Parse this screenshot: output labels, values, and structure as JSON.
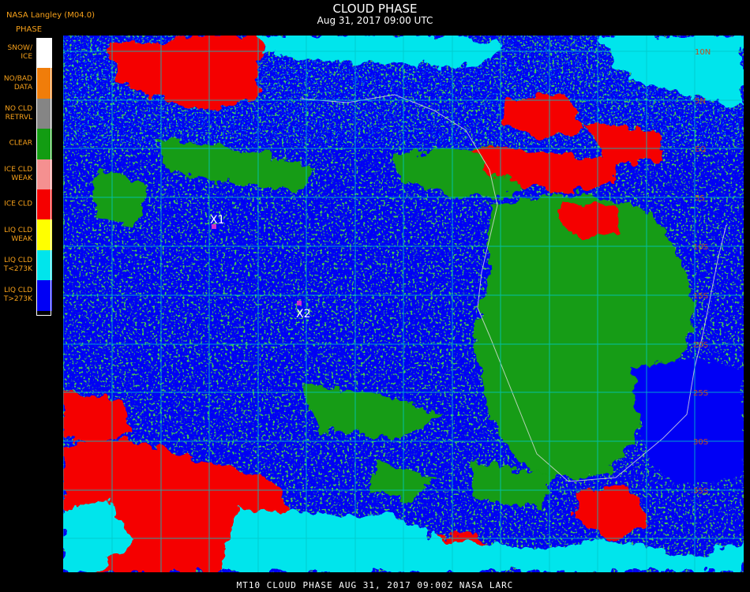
{
  "header": {
    "source": "NASA Langley (M04.0)",
    "title": "CLOUD PHASE",
    "subtitle": "Aug 31, 2017 09:00 UTC"
  },
  "legend": {
    "title": "PHASE",
    "items": [
      {
        "label": "SNOW/\nICE",
        "color": "#ffffff"
      },
      {
        "label": "NO/BAD\nDATA",
        "color": "#f07d0a"
      },
      {
        "label": "NO CLD\nRETRVL",
        "color": "#858585"
      },
      {
        "label": "CLEAR",
        "color": "#129c12"
      },
      {
        "label": "ICE CLD\nWEAK",
        "color": "#f59090"
      },
      {
        "label": "ICE CLD",
        "color": "#f50000"
      },
      {
        "label": "LIQ CLD\nWEAK",
        "color": "#ffff00"
      },
      {
        "label": "LIQ CLD\nT<273K",
        "color": "#00e5ec"
      },
      {
        "label": "LIQ CLD\nT>273K",
        "color": "#0000f5"
      }
    ]
  },
  "markers": [
    {
      "label": "X1",
      "color": "#cc33cc"
    },
    {
      "label": "X2",
      "color": "#cc33cc"
    }
  ],
  "grid_labels": [
    "10N",
    "5N",
    "EQ",
    "5S",
    "10S",
    "15S",
    "20S",
    "25S",
    "30S",
    "35S"
  ],
  "footer": "MT10  CLOUD PHASE   AUG 31, 2017 09:00Z   NASA LARC"
}
